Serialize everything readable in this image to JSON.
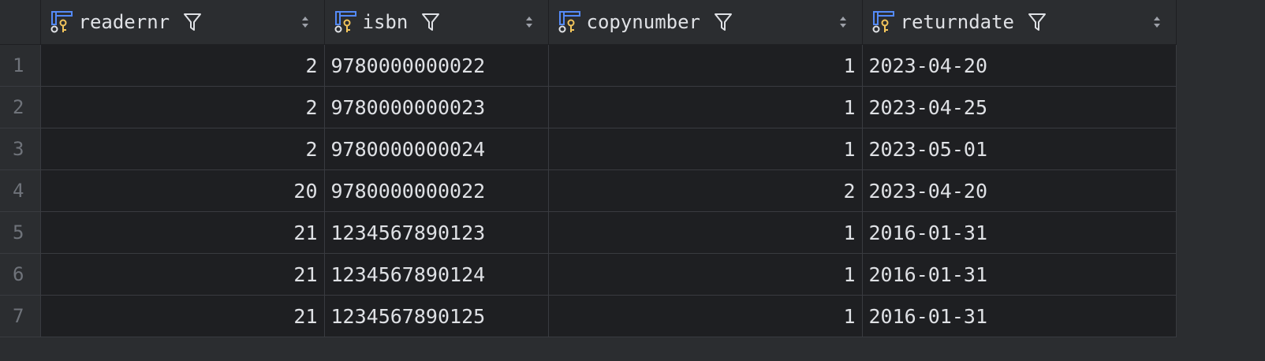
{
  "columns": [
    {
      "name": "readernr",
      "align": "right"
    },
    {
      "name": "isbn",
      "align": "left"
    },
    {
      "name": "copynumber",
      "align": "right"
    },
    {
      "name": "returndate",
      "align": "left"
    }
  ],
  "rows": [
    {
      "row_number": "1",
      "readernr": "2",
      "isbn": "9780000000022",
      "copynumber": "1",
      "returndate": "2023-04-20"
    },
    {
      "row_number": "2",
      "readernr": "2",
      "isbn": "9780000000023",
      "copynumber": "1",
      "returndate": "2023-04-25"
    },
    {
      "row_number": "3",
      "readernr": "2",
      "isbn": "9780000000024",
      "copynumber": "1",
      "returndate": "2023-05-01"
    },
    {
      "row_number": "4",
      "readernr": "20",
      "isbn": "9780000000022",
      "copynumber": "2",
      "returndate": "2023-04-20"
    },
    {
      "row_number": "5",
      "readernr": "21",
      "isbn": "1234567890123",
      "copynumber": "1",
      "returndate": "2016-01-31"
    },
    {
      "row_number": "6",
      "readernr": "21",
      "isbn": "1234567890124",
      "copynumber": "1",
      "returndate": "2016-01-31"
    },
    {
      "row_number": "7",
      "readernr": "21",
      "isbn": "1234567890125",
      "copynumber": "1",
      "returndate": "2016-01-31"
    }
  ],
  "icons": {
    "column": "primary-key-column-icon",
    "filter": "filter-icon",
    "sort": "sort-icon"
  },
  "colors": {
    "background": "#1e1f22",
    "header_background": "#2b2d30",
    "text": "#dfe1e5",
    "row_number_text": "#6f737a",
    "column_icon_blue": "#548af7",
    "key_icon_yellow": "#f2c55c"
  }
}
